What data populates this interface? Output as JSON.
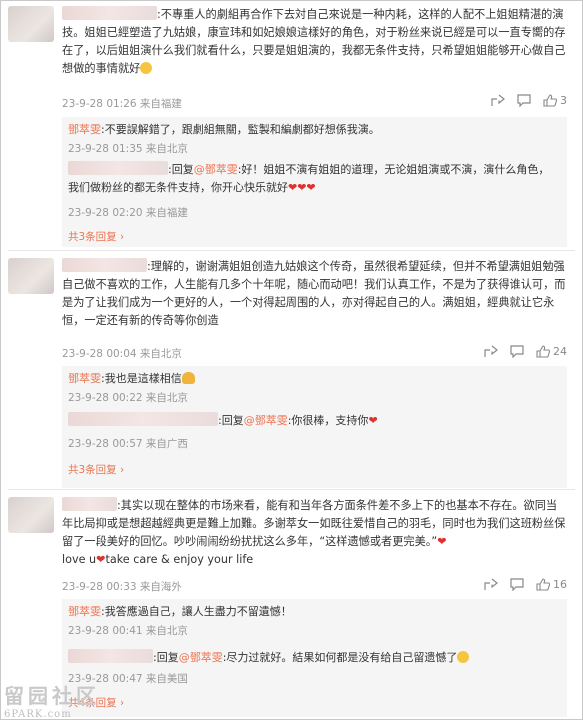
{
  "threads": [
    {
      "text": ":不專重人的劇組再合作下去対自己來说是一种内耗，这样的人配不上姐姐精湛的演技。姐姐已經塑造了九姑娘，康宣玮和如妃娘娘這樣好的角色，对于粉丝来说已經是可以一直专嚮的存在了，以后姐姐演什么我们就看什么，只要是姐姐演的，我都无条件支持，只希望姐姐能够开心做自己想做的事情就好",
      "meta": "23-9-28 01:26 来自福建",
      "likes": "3",
      "replies": [
        {
          "author": "鄧萃雯",
          "text": ":不要誤解錯了，跟劇組無關，監製和編劇都好想係我演。",
          "meta": "23-9-28 01:35 来自北京"
        },
        {
          "prefix": ":回复",
          "mention": "@鄧萃雯",
          "text": ":好！姐姐不演有姐姐的道理，无论姐姐演或不演，演什么角色，我们做粉丝的都无条件支持，你开心快乐就好",
          "hearts": "❤❤❤",
          "meta": "23-9-28 02:20 来自福建"
        }
      ],
      "more": "共3条回复"
    },
    {
      "text": ":理解的，谢谢满姐姐创造九姑娘这个传奇，虽然很希望延续，但并不希望满姐姐勉强自己做不喜欢的工作，人生能有几多个十年呢，随心而动吧！我们认真工作，不是为了获得谁认可，而是为了让我们成为一个更好的人，一个对得起周围的人，亦对得起自己的人。满姐姐，經典就让它永恒，一定还有新的传奇等你创造",
      "meta": "23-9-28 00:04 来自北京",
      "likes": "24",
      "replies": [
        {
          "author": "鄧萃雯",
          "text": ":我也是這樣相信",
          "emoji": "muscle",
          "meta": "23-9-28 00:22 来自北京"
        },
        {
          "prefix": ":回复",
          "mention": "@鄧萃雯",
          "text": ":你很棒，支持你",
          "hearts": "❤",
          "meta": "23-9-28 00:57 来自广西"
        }
      ],
      "more": "共3条回复"
    },
    {
      "text": ":其实以现在整体的市场来看，能有和当年各方面条件差不多上下的也基本不存在。欲同当年比局抑或是想超越經典更是難上加難。多谢萃女一如既往爱惜自己的羽毛，同时也为我们这班粉丝保留了一段美好的回忆。吵吵闹闹纷纷扰扰这么多年，“这样遗憾或者更完美。”",
      "text2": "love u",
      "text3": "take care & enjoy your life",
      "meta": "23-9-28 00:33 来自海外",
      "likes": "16",
      "replies": [
        {
          "author": "鄧萃雯",
          "text": ":我答應過自己，讓人生盡力不留遺憾！",
          "meta": "23-9-28 00:41 来自北京"
        },
        {
          "prefix": ":回复",
          "mention": "@鄧萃雯",
          "text": ":尽力过就好。結果如何都是没有给自己留遗憾了",
          "meta": "23-9-28 00:47 来自美国"
        }
      ],
      "more": "共4条回复"
    }
  ],
  "watermark": {
    "line1": "留园社区",
    "line2": "6PARK.com"
  },
  "colors": {
    "accent": "#eb7350",
    "heart": "#e0312f"
  },
  "icons": [
    "share-icon",
    "comment-icon",
    "like-icon"
  ]
}
